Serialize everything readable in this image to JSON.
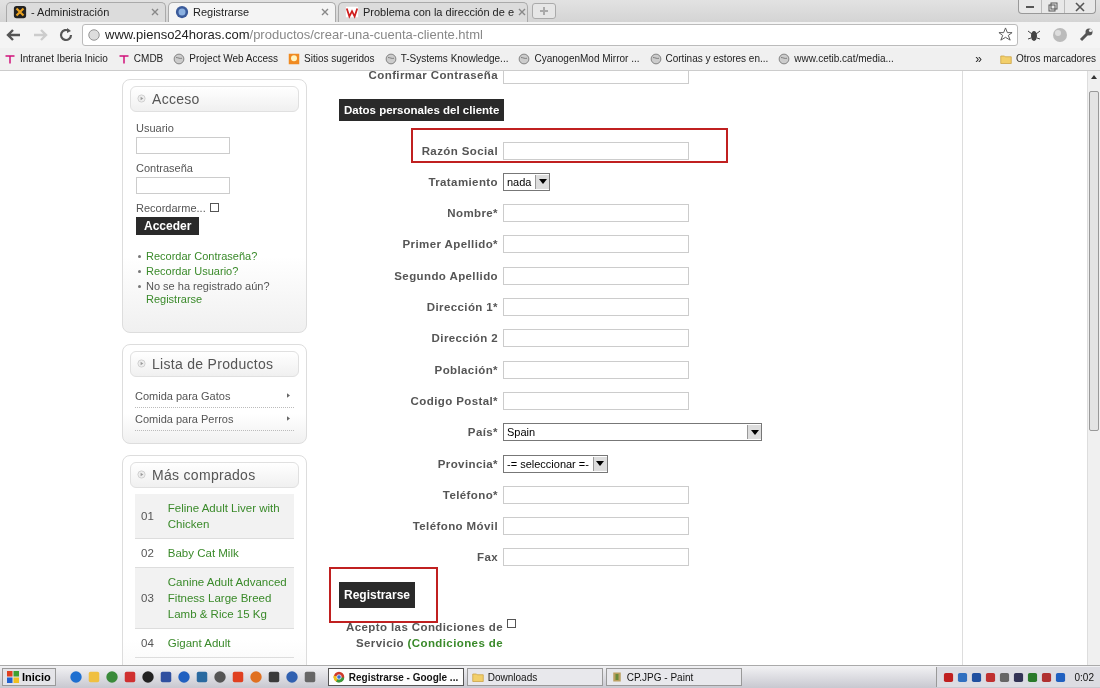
{
  "browser": {
    "tabs": [
      {
        "title": "- Administración",
        "selected": false
      },
      {
        "title": "Registrarse",
        "selected": true
      },
      {
        "title": "Problema con la dirección de e",
        "selected": false
      }
    ],
    "address": {
      "host": "www.pienso24horas.com",
      "path": "/productos/crear-una-cuenta-cliente.html"
    },
    "bookmarks": [
      "Intranet Iberia Inicio",
      "CMDB",
      "Project Web Access",
      "Sitios sugeridos",
      "T-Systems Knowledge...",
      "CyanogenMod Mirror ...",
      "Cortinas y estores en...",
      "www.cetib.cat/media..."
    ],
    "more_bookmarks": "»",
    "other_bookmarks": "Otros marcadores"
  },
  "sidebar": {
    "login": {
      "title": "Acceso",
      "user_label": "Usuario",
      "password_label": "Contraseña",
      "remember_label": "Recordarme...",
      "remember_checked": false,
      "submit": "Acceder",
      "links": [
        {
          "text": "Recordar Contraseña?",
          "kind": "link"
        },
        {
          "text": "Recordar Usuario?",
          "kind": "link"
        },
        {
          "text": "No se ha registrado aún?",
          "kind": "text",
          "link": "Registrarse"
        }
      ]
    },
    "products": {
      "title": "Lista de Productos",
      "items": [
        "Comida para Gatos",
        "Comida para Perros"
      ]
    },
    "top_sellers": {
      "title": "Más comprados",
      "items": [
        {
          "rank": "01",
          "name": "Feline Adult Liver with Chicken"
        },
        {
          "rank": "02",
          "name": "Baby Cat Milk"
        },
        {
          "rank": "03",
          "name": "Canine Adult Advanced Fitness Large Breed Lamb & Rice 15 Kg"
        },
        {
          "rank": "04",
          "name": "Gigant Adult"
        }
      ]
    }
  },
  "form": {
    "previous_label": "Confirmar Contraseña",
    "section_title": "Datos personales del cliente",
    "fields": [
      {
        "label": "Razón Social",
        "kind": "text",
        "highlighted": true
      },
      {
        "label": "Tratamiento",
        "kind": "select",
        "value": "nada",
        "wide": false,
        "highlighted": false
      },
      {
        "label": "Nombre*",
        "kind": "text",
        "highlighted": false
      },
      {
        "label": "Primer Apellido*",
        "kind": "text",
        "highlighted": false
      },
      {
        "label": "Segundo Apellido",
        "kind": "text",
        "highlighted": false
      },
      {
        "label": "Dirección 1*",
        "kind": "text",
        "highlighted": false
      },
      {
        "label": "Dirección 2",
        "kind": "text",
        "highlighted": false
      },
      {
        "label": "Población*",
        "kind": "text",
        "highlighted": false
      },
      {
        "label": "Codigo Postal*",
        "kind": "text",
        "highlighted": false
      },
      {
        "label": "País*",
        "kind": "select",
        "value": "Spain",
        "wide": true,
        "highlighted": false
      },
      {
        "label": "Provincia*",
        "kind": "select",
        "value": "-= seleccionar =-",
        "wide": false,
        "highlighted": false
      },
      {
        "label": "Teléfono*",
        "kind": "text",
        "highlighted": false
      },
      {
        "label": "Teléfono Móvil",
        "kind": "text",
        "highlighted": false
      },
      {
        "label": "Fax",
        "kind": "text",
        "highlighted": false
      }
    ],
    "submit": {
      "label": "Registrarse",
      "highlighted": true
    },
    "terms": {
      "text": "Acepto las Condiciones de Servicio",
      "link": "(Condiciones de",
      "checked": false
    }
  },
  "taskbar": {
    "start": "Inicio",
    "tasks": [
      {
        "label": "Registrarse - Google ...",
        "selected": true
      },
      {
        "label": "Downloads",
        "selected": false
      },
      {
        "label": "CP.JPG - Paint",
        "selected": false
      }
    ],
    "clock": "0:02"
  }
}
